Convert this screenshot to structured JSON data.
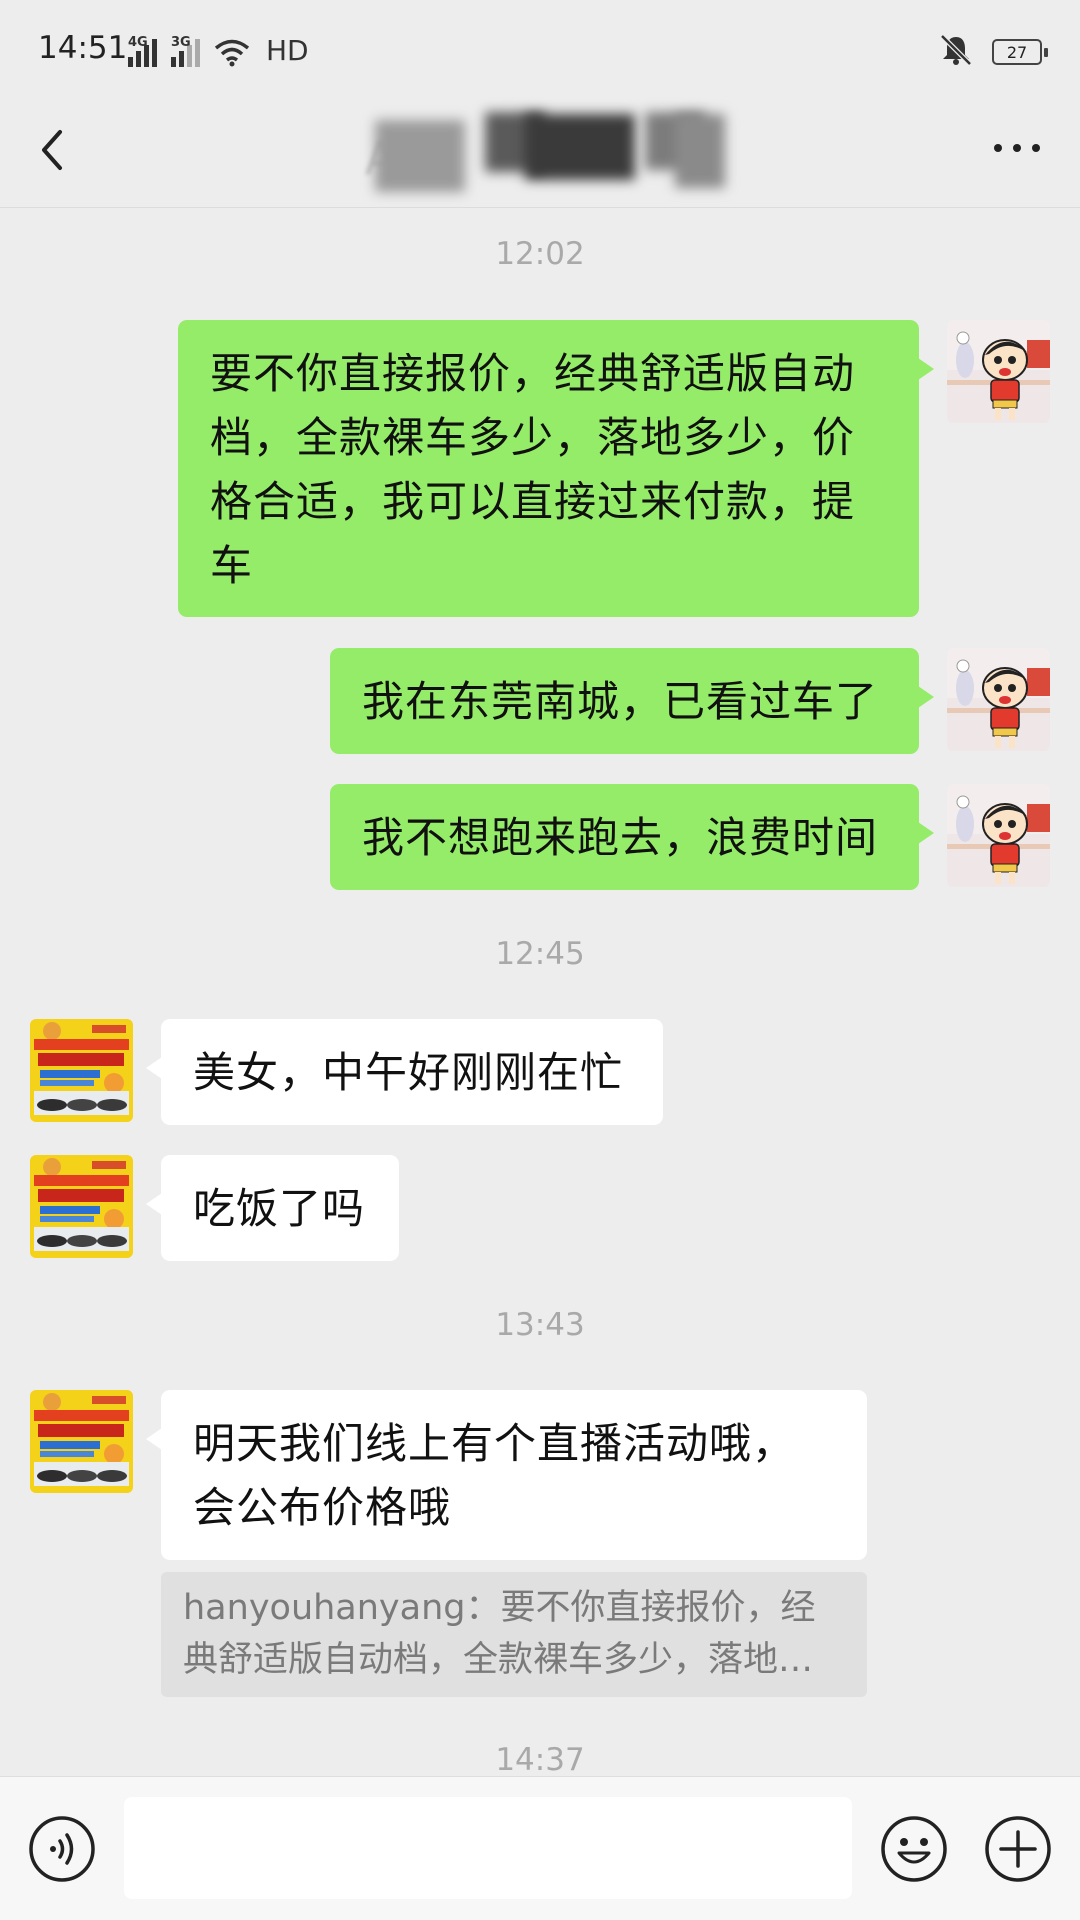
{
  "status_bar": {
    "time": "14:51",
    "signal1_label": "4G",
    "signal2_label": "3G",
    "hd_label": "HD",
    "battery_level": "27",
    "icons": [
      "signal-4g-icon",
      "signal-3g-icon",
      "wifi-icon",
      "mute-icon",
      "battery-icon"
    ]
  },
  "header": {
    "title": "A棒",
    "icons": [
      "chevron-left-icon",
      "more-icon"
    ]
  },
  "messages": [
    {
      "time": "12:02"
    },
    {
      "side": "me",
      "text": "要不你直接报价，经典舒适版自动档，全款裸车多少，落地多少，价格合适，我可以直接过来付款，提车"
    },
    {
      "side": "me",
      "text": "我在东莞南城，已看过车了"
    },
    {
      "side": "me",
      "text": "我不想跑来跑去，浪费时间"
    },
    {
      "time": "12:45"
    },
    {
      "side": "them",
      "text": "美女，中午好刚刚在忙"
    },
    {
      "side": "them",
      "text": "吃饭了吗"
    },
    {
      "time": "13:43"
    },
    {
      "side": "them",
      "text": "明天我们线上有个直播活动哦，会公布价格哦"
    },
    {
      "quote_line1": "hanyouhanyang：要不你直接报价，经",
      "quote_line2": "典舒适版自动档，全款裸车多少，落地…"
    },
    {
      "time": "14:37"
    }
  ],
  "input_bar": {
    "icons": [
      "voice-icon",
      "emoji-icon",
      "plus-icon"
    ]
  },
  "colors": {
    "my_bubble": "#95ec69",
    "their_bubble": "#ffffff",
    "background": "#ededed"
  }
}
